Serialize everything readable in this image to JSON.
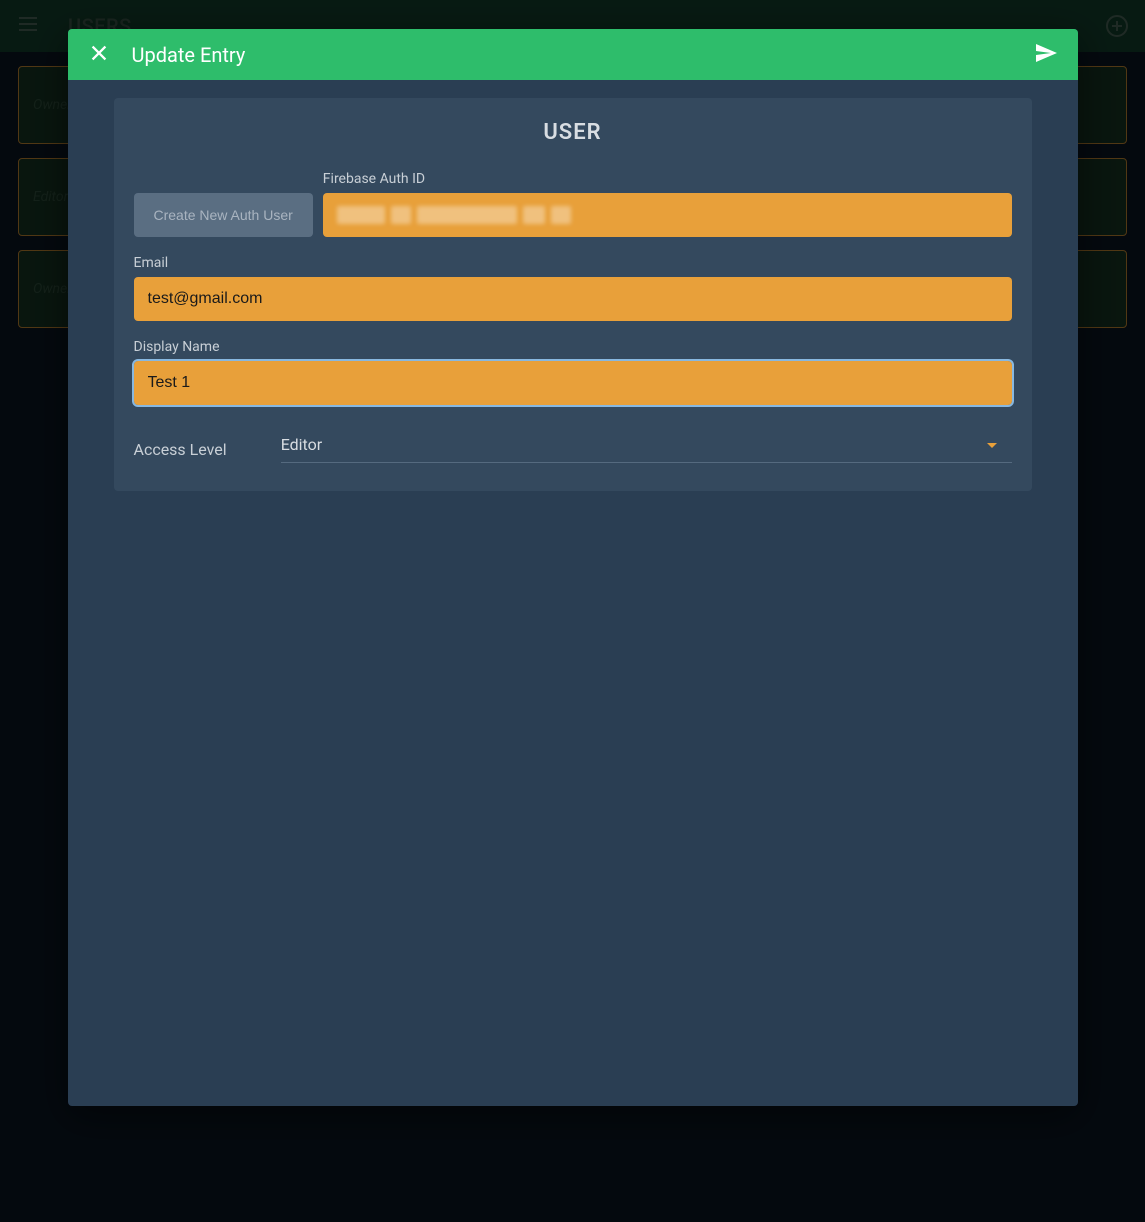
{
  "appbar": {
    "title": "USERS"
  },
  "background_rows": [
    {
      "role": "Owner"
    },
    {
      "role": "Editor"
    },
    {
      "role": "Owner"
    }
  ],
  "modal": {
    "title": "Update Entry",
    "panel_title": "USER",
    "create_auth_label": "Create New Auth User",
    "firebase_auth": {
      "label": "Firebase Auth ID",
      "value_masked": true
    },
    "email": {
      "label": "Email",
      "value": "test@gmail.com"
    },
    "display_name": {
      "label": "Display Name",
      "value": "Test 1"
    },
    "access_level": {
      "label": "Access Level",
      "value": "Editor"
    }
  }
}
